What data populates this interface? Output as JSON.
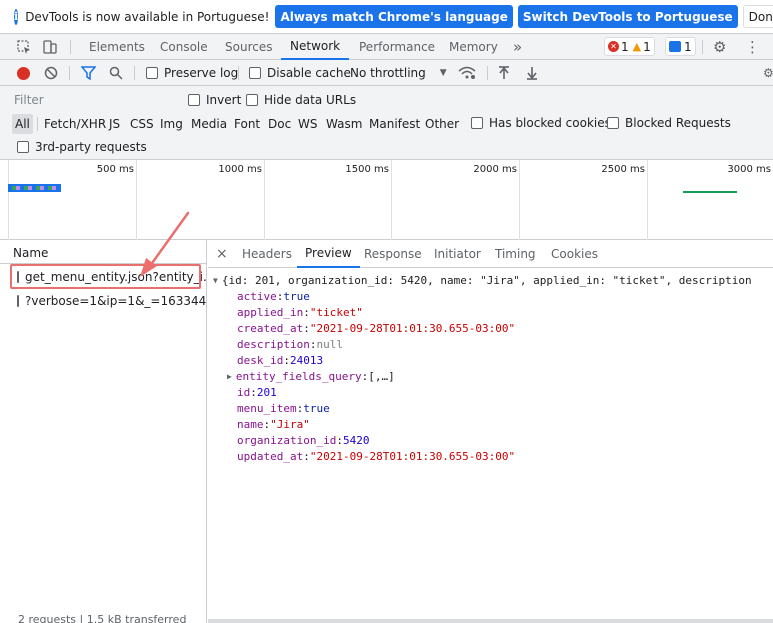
{
  "infobar": {
    "text": "DevTools is now available in Portuguese!",
    "match_button": "Always match Chrome's language",
    "switch_button": "Switch DevTools to Portuguese",
    "dismiss_button": "Don't show again"
  },
  "tabs": [
    "Elements",
    "Console",
    "Sources",
    "Network",
    "Performance",
    "Memory"
  ],
  "overflow": "»",
  "badges": {
    "errors": "1",
    "warnings": "1",
    "messages": "1"
  },
  "toolbar": {
    "preserve_log": "Preserve log",
    "disable_cache": "Disable cache",
    "throttling": "No throttling"
  },
  "filter": {
    "placeholder": "Filter",
    "invert": "Invert",
    "hide_data_urls": "Hide data URLs",
    "types": [
      "All",
      "Fetch/XHR",
      "JS",
      "CSS",
      "Img",
      "Media",
      "Font",
      "Doc",
      "WS",
      "Wasm",
      "Manifest",
      "Other"
    ],
    "blocked_cookies": "Has blocked cookies",
    "blocked_requests": "Blocked Requests",
    "third_party": "3rd-party requests"
  },
  "timeline": {
    "ticks": [
      "500 ms",
      "1000 ms",
      "1500 ms",
      "2000 ms",
      "2500 ms",
      "3000 ms"
    ]
  },
  "requests": {
    "header": "Name",
    "rows": [
      "get_menu_entity.json?entity_i...",
      "?verbose=1&ip=1&_=163344..."
    ],
    "footer": "2 requests | 1.5 kB transferred"
  },
  "detail_tabs": {
    "close": "×",
    "items": [
      "Headers",
      "Preview",
      "Response",
      "Initiator",
      "Timing",
      "Cookies"
    ]
  },
  "preview": {
    "summary": "{id: 201, organization_id: 5420, name: \"Jira\", applied_in: \"ticket\", description",
    "fields": [
      {
        "key": "active",
        "value": "true",
        "type": "bool"
      },
      {
        "key": "applied_in",
        "value": "\"ticket\"",
        "type": "str"
      },
      {
        "key": "created_at",
        "value": "\"2021-09-28T01:01:30.655-03:00\"",
        "type": "str"
      },
      {
        "key": "description",
        "value": "null",
        "type": "nul"
      },
      {
        "key": "desk_id",
        "value": "24013",
        "type": "num"
      },
      {
        "key": "entity_fields_query",
        "value": "[,…]",
        "type": "punc"
      },
      {
        "key": "id",
        "value": "201",
        "type": "num"
      },
      {
        "key": "menu_item",
        "value": "true",
        "type": "bool"
      },
      {
        "key": "name",
        "value": "\"Jira\"",
        "type": "str"
      },
      {
        "key": "organization_id",
        "value": "5420",
        "type": "num"
      },
      {
        "key": "updated_at",
        "value": "\"2021-09-28T01:01:30.655-03:00\"",
        "type": "str"
      }
    ]
  }
}
